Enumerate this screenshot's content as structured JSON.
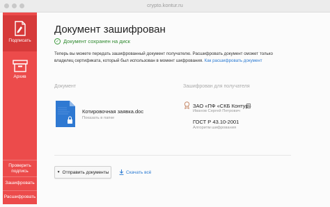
{
  "window": {
    "url": "crypto.kontur.ru"
  },
  "sidebar": {
    "sign": "Подписать",
    "archive": "Архив",
    "verify_line1": "Проверить",
    "verify_line2": "подпись",
    "encrypt": "Зашифровать",
    "decrypt": "Расшифровать",
    "accent_color": "#ec4b4b"
  },
  "main": {
    "title": "Документ зашифрован",
    "saved_status": "Документ сохранен на диск",
    "description": "Теперь вы можете передать зашифрованный документ получателю. Расшифровать документ сможет только владелец сертификата, который был использован в момент шифрования.",
    "decrypt_link": "Как расшифровать документ",
    "document_label": "Документ",
    "encrypted_for_label": "Зашифрован для получателя",
    "document_name": "Котировочная заявка.doc",
    "show_in_folder": "Показать в папке",
    "cert_org": "ЗАО «ПФ «СКБ Контур»",
    "cert_person": "Иванов Сергей Петрович",
    "gost": "ГОСТ Р 43.10-2001",
    "algorithm": "Алгоритм шифрования",
    "send_button": "Отправить документы",
    "download_all": "Скачать всё"
  }
}
